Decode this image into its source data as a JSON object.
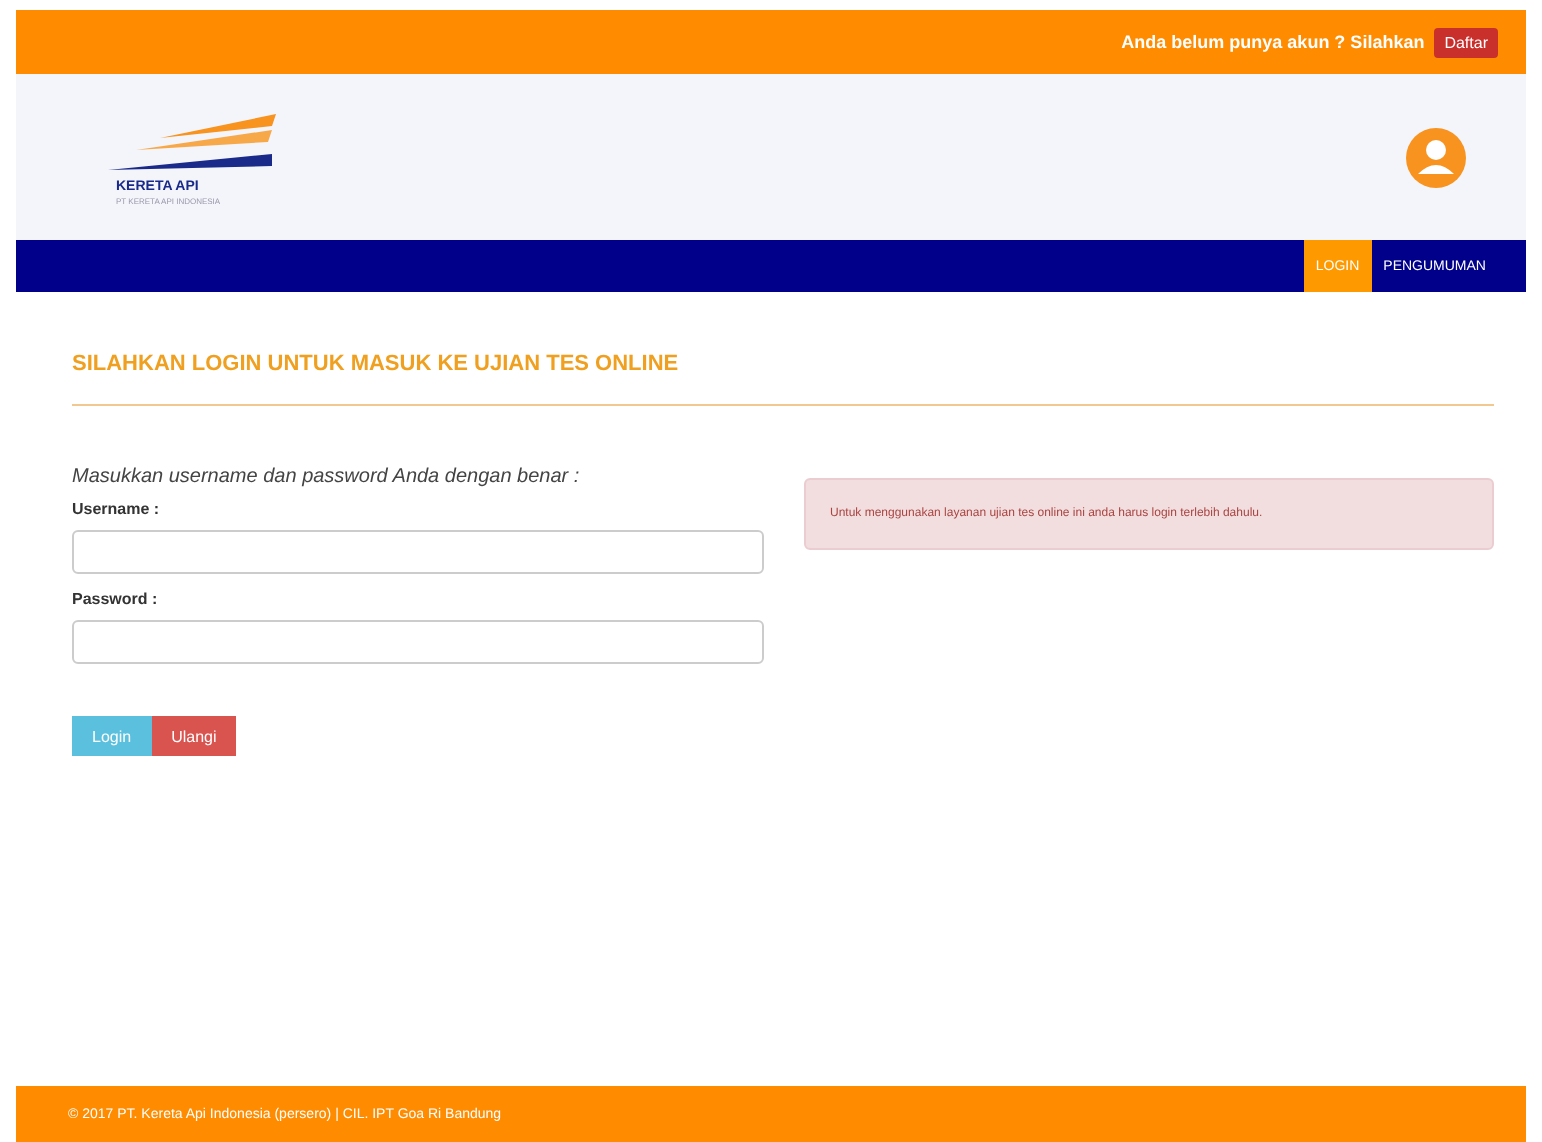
{
  "top_bar": {
    "text": "Anda belum punya akun ? Silahkan",
    "button": "Daftar"
  },
  "logo": {
    "name": "KERETA API",
    "tagline": "PT KERETA API INDONESIA"
  },
  "nav": [
    {
      "label": "LOGIN",
      "selected": true
    },
    {
      "label": "PENGUMUMAN",
      "selected": false
    }
  ],
  "title": "SILAHKAN LOGIN UNTUK MASUK KE UJIAN TES ONLINE",
  "form": {
    "intro": "Masukkan username dan password Anda dengan benar :",
    "fields": [
      {
        "label": "Username :"
      },
      {
        "label": "Password :"
      }
    ],
    "buttons": [
      {
        "label": "Login",
        "kind": "primary"
      },
      {
        "label": "Ulangi",
        "kind": "danger"
      }
    ]
  },
  "alert": "Untuk menggunakan layanan ujian tes online ini anda harus login terlebih dahulu.",
  "footer": "© 2017 PT. Kereta Api Indonesia (persero) | CIL. IPT Goa Ri Bandung"
}
